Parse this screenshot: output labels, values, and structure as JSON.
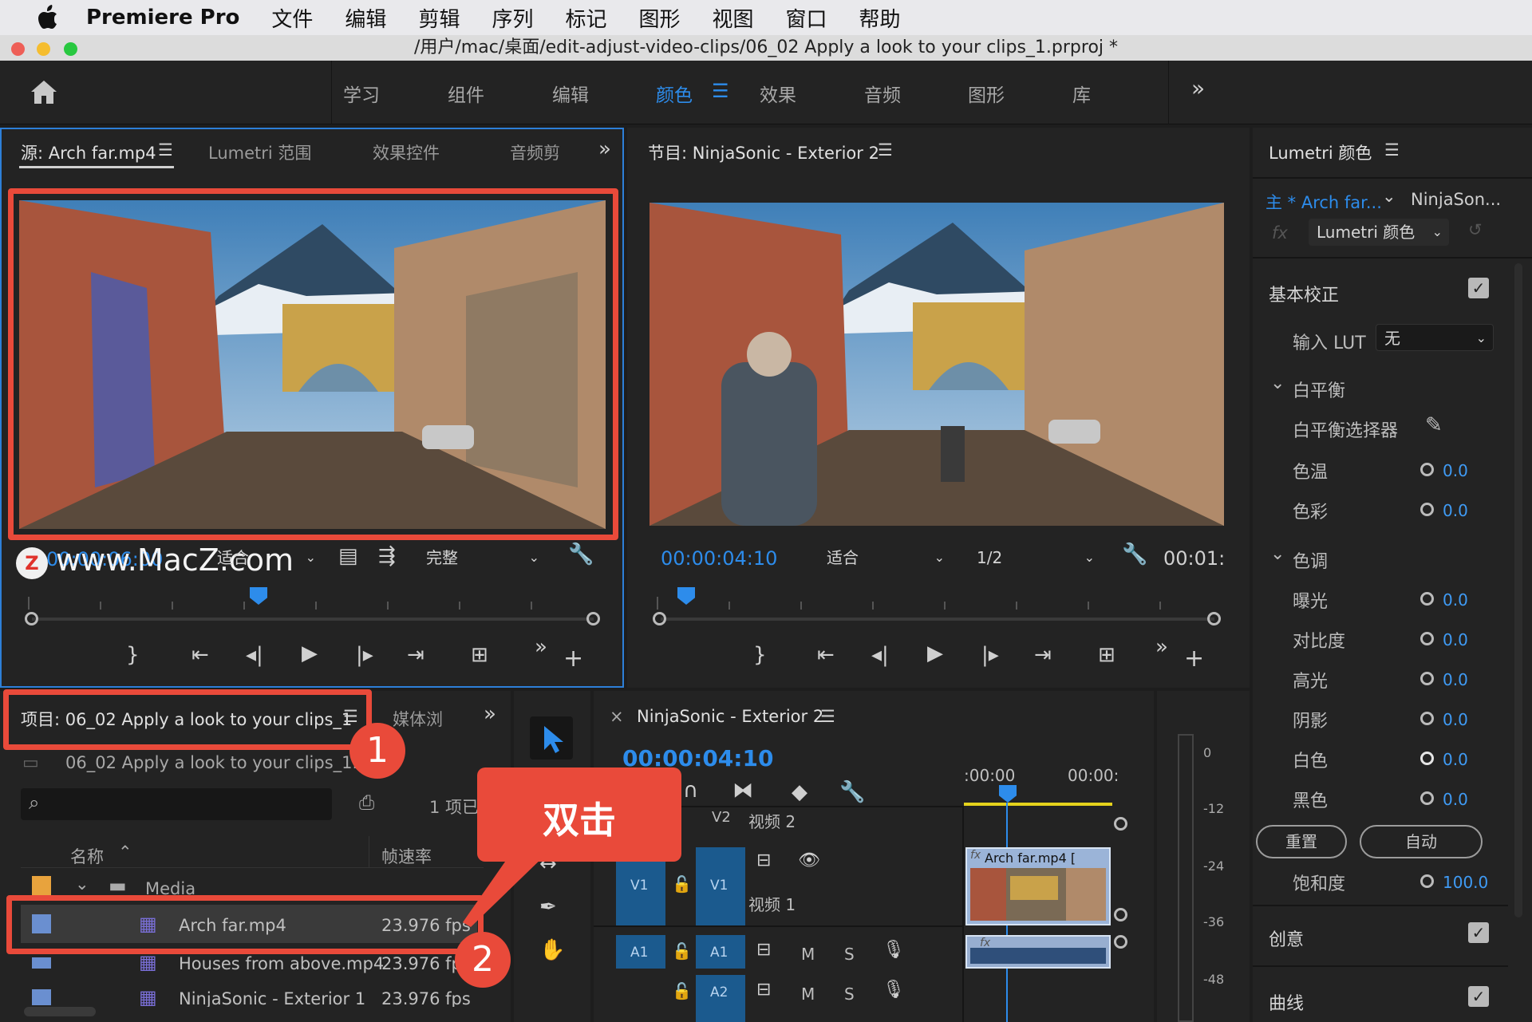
{
  "menubar": {
    "app_name": "Premiere Pro",
    "items": [
      "文件",
      "编辑",
      "剪辑",
      "序列",
      "标记",
      "图形",
      "视图",
      "窗口",
      "帮助"
    ]
  },
  "titlebar": {
    "path": "/用户/mac/桌面/edit-adjust-video-clips/06_02 Apply a look to your clips_1.prproj *"
  },
  "workspaces": {
    "items": [
      "学习",
      "组件",
      "编辑",
      "颜色",
      "效果",
      "音频",
      "图形",
      "库"
    ],
    "active": "颜色",
    "menu_icon": "hamburger-icon",
    "overflow": "»"
  },
  "source_panel": {
    "tabs": [
      "源: Arch far.mp4",
      "Lumetri 范围",
      "效果控件",
      "音频剪"
    ],
    "timecode": "00:00:06:00",
    "fit_value": "适合",
    "quality_value": "完整",
    "watermark": "www.MacZ.com"
  },
  "program_panel": {
    "title": "节目: NinjaSonic - Exterior 2",
    "timecode": "00:00:04:10",
    "fit_value": "适合",
    "resolution_value": "1/2",
    "end_timecode": "00:01:"
  },
  "lumetri": {
    "title": "Lumetri 颜色",
    "master_clip": "主 * Arch far...",
    "sequence_clip": "NinjaSon...",
    "effect_dropdown": "Lumetri 颜色",
    "basic_correction": "基本校正",
    "input_lut_label": "输入 LUT",
    "input_lut_value": "无",
    "white_balance": "白平衡",
    "wb_selector": "白平衡选择器",
    "temperature": {
      "label": "色温",
      "value": "0.0"
    },
    "tint": {
      "label": "色彩",
      "value": "0.0"
    },
    "tone": "色调",
    "tone_rows": [
      {
        "label": "曝光",
        "value": "0.0"
      },
      {
        "label": "对比度",
        "value": "0.0"
      },
      {
        "label": "高光",
        "value": "0.0"
      },
      {
        "label": "阴影",
        "value": "0.0"
      },
      {
        "label": "白色",
        "value": "0.0"
      },
      {
        "label": "黑色",
        "value": "0.0"
      }
    ],
    "reset_button": "重置",
    "auto_button": "自动",
    "saturation": {
      "label": "饱和度",
      "value": "100.0"
    },
    "creative": "创意",
    "curves": "曲线"
  },
  "project_panel": {
    "tab": "项目: 06_02 Apply a look to your clips_1",
    "tab2": "媒体浏",
    "file_name": "06_02 Apply a look to your clips_1.prj",
    "items_count": "1 项已",
    "col_name": "名称",
    "col_fps": "帧速率",
    "rows": [
      {
        "name": "Media",
        "fps": ""
      },
      {
        "name": "Arch far.mp4",
        "fps": "23.976 fps"
      },
      {
        "name": "Houses from above.mp4",
        "fps": "23.976 fp"
      },
      {
        "name": "NinjaSonic - Exterior 1",
        "fps": "23.976 fps"
      }
    ]
  },
  "timeline": {
    "title": "NinjaSonic - Exterior 2",
    "timecode": "00:00:04:10",
    "ruler_start": ":00:00",
    "ruler_end": "00:00:",
    "tracks": {
      "v2_label": "V2",
      "v2_name": "视频 2",
      "v1_label": "V1",
      "v1_name": "视频 1",
      "a1_label": "A1",
      "a2_label": "A2",
      "mute": "M",
      "solo": "S"
    },
    "clip_name": "Arch far.mp4 ["
  },
  "audio_meter": {
    "ticks": [
      "0",
      "-12",
      "-24",
      "-36",
      "-48"
    ]
  },
  "annotations": {
    "badge1": "1",
    "badge2": "2",
    "callout": "双击"
  },
  "colors": {
    "accent": "#2d8ceb",
    "highlight": "#e94a3a",
    "panel": "#232323"
  }
}
